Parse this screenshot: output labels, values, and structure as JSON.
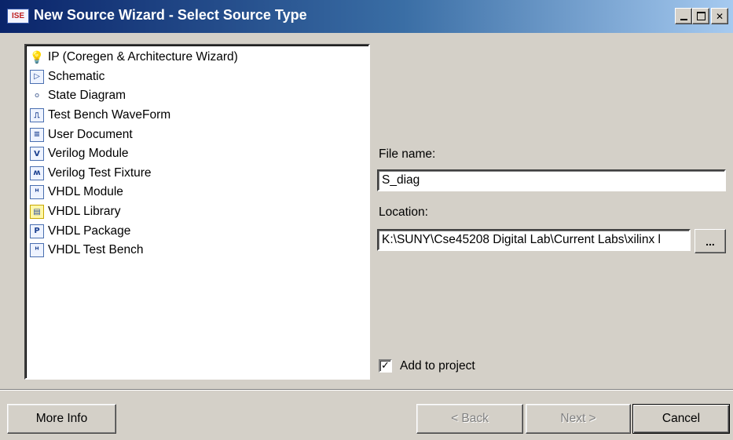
{
  "window": {
    "app_icon_text": "ISE",
    "title": "New Source Wizard - Select Source Type"
  },
  "source_types": [
    {
      "label": "IP (Coregen & Architecture Wizard)",
      "icon": "lightbulb-icon",
      "glyph": "💡"
    },
    {
      "label": "Schematic",
      "icon": "schematic-icon",
      "glyph": "▷"
    },
    {
      "label": "State Diagram",
      "icon": "state-diagram-icon",
      "glyph": "⚬"
    },
    {
      "label": "Test Bench WaveForm",
      "icon": "waveform-icon",
      "glyph": "⎍"
    },
    {
      "label": "User Document",
      "icon": "document-icon",
      "glyph": "≡"
    },
    {
      "label": "Verilog Module",
      "icon": "verilog-module-icon",
      "glyph": "V"
    },
    {
      "label": "Verilog Test Fixture",
      "icon": "verilog-test-fixture-icon",
      "glyph": "ʍ"
    },
    {
      "label": "VHDL Module",
      "icon": "vhdl-module-icon",
      "glyph": "ᴴ"
    },
    {
      "label": "VHDL Library",
      "icon": "vhdl-library-icon",
      "glyph": "▤"
    },
    {
      "label": "VHDL Package",
      "icon": "vhdl-package-icon",
      "glyph": "P"
    },
    {
      "label": "VHDL Test Bench",
      "icon": "vhdl-test-bench-icon",
      "glyph": "ᴴ"
    }
  ],
  "form": {
    "file_name_label": "File name:",
    "file_name_value": "S_diag",
    "location_label": "Location:",
    "location_value": "K:\\SUNY\\Cse45208 Digital Lab\\Current Labs\\xilinx l",
    "browse_label": "...",
    "add_to_project_label": "Add to project",
    "add_to_project_checked": "✓"
  },
  "buttons": {
    "more_info": "More Info",
    "back": "< Back",
    "next": "Next >",
    "cancel": "Cancel"
  }
}
